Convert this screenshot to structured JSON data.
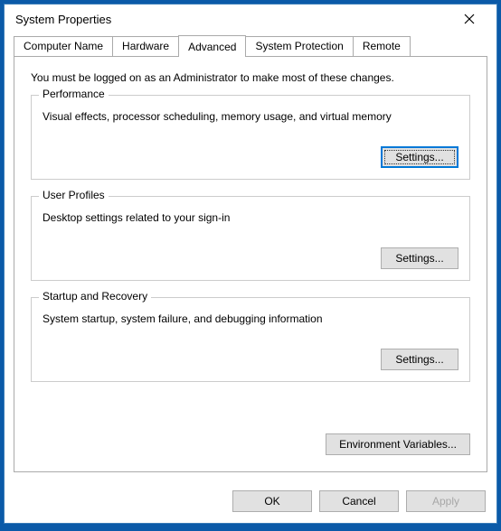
{
  "window": {
    "title": "System Properties"
  },
  "tabs": {
    "computer_name": "Computer Name",
    "hardware": "Hardware",
    "advanced": "Advanced",
    "system_protection": "System Protection",
    "remote": "Remote"
  },
  "advanced_panel": {
    "intro": "You must be logged on as an Administrator to make most of these changes.",
    "performance": {
      "title": "Performance",
      "desc": "Visual effects, processor scheduling, memory usage, and virtual memory",
      "button": "Settings..."
    },
    "user_profiles": {
      "title": "User Profiles",
      "desc": "Desktop settings related to your sign-in",
      "button": "Settings..."
    },
    "startup_recovery": {
      "title": "Startup and Recovery",
      "desc": "System startup, system failure, and debugging information",
      "button": "Settings..."
    },
    "env_vars_button": "Environment Variables..."
  },
  "buttons": {
    "ok": "OK",
    "cancel": "Cancel",
    "apply": "Apply"
  }
}
